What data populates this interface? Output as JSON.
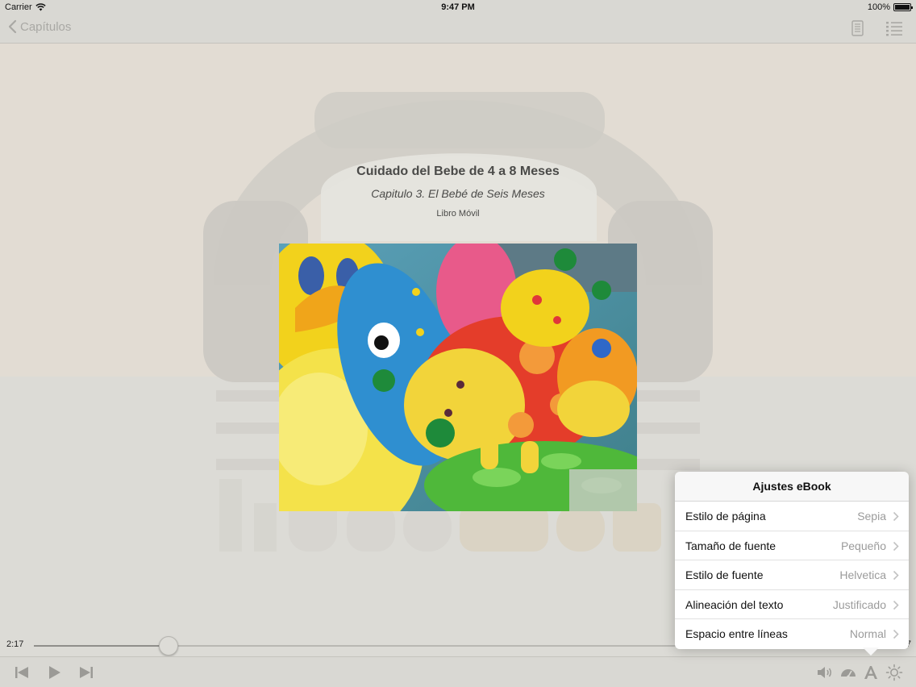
{
  "status_bar": {
    "carrier": "Carrier",
    "time": "9:47 PM",
    "battery": "100%"
  },
  "nav": {
    "back_label": "Capítulos",
    "icons": [
      "page-view-icon",
      "chapter-list-icon"
    ]
  },
  "book": {
    "title": "Cuidado del Bebe de 4 a 8 Meses",
    "chapter": "Capitulo 3. El Bebé de Seis Meses",
    "publisher": "Libro Móvil"
  },
  "player": {
    "elapsed": "2:17",
    "remaining": "7",
    "progress_fraction": 0.155,
    "controls": [
      "skip-back-icon",
      "play-icon",
      "skip-forward-icon"
    ],
    "right_controls": [
      "volume-icon",
      "speed-gauge-icon",
      "font-settings-icon",
      "brightness-icon"
    ]
  },
  "popover": {
    "title": "Ajustes eBook",
    "rows": [
      {
        "label": "Estilo de página",
        "value": "Sepia"
      },
      {
        "label": "Tamaño de fuente",
        "value": "Pequeño"
      },
      {
        "label": "Estilo de fuente",
        "value": "Helvetica"
      },
      {
        "label": "Alineación del texto",
        "value": "Justificado"
      },
      {
        "label": "Espacio entre líneas",
        "value": "Normal"
      }
    ]
  },
  "colors": {
    "background": "#dcdbd6",
    "sepia": "#e2dcd3",
    "accent_text": "#4a4a48",
    "value_gray": "#9b9b9b"
  }
}
